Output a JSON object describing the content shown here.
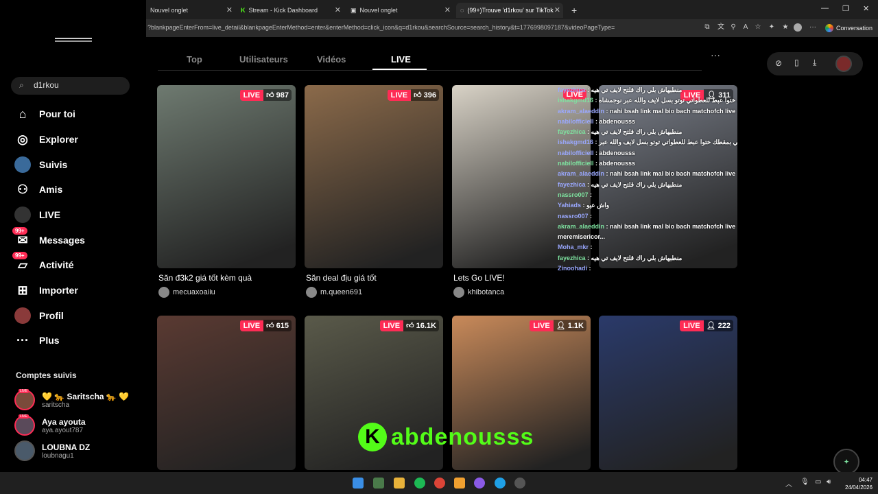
{
  "browser": {
    "tabs": [
      {
        "label": "Nouvel onglet"
      },
      {
        "label": "Stream - Kick Dashboard"
      },
      {
        "label": "Nouvel onglet"
      },
      {
        "label": "(99+)Trouve 'd1rkou' sur TikTok | ..."
      }
    ],
    "url": "?blankpageEnterFrom=live_detail&blankpageEnterMethod=enter&enterMethod=click_icon&q=d1rkou&searchSource=search_history&t=1776998097187&videoPageType=",
    "conversation_label": "Conversation"
  },
  "search": {
    "value": "d1rkou"
  },
  "nav": [
    {
      "label": "Pour toi",
      "icon": "home-icon"
    },
    {
      "label": "Explorer",
      "icon": "compass-icon"
    },
    {
      "label": "Suivis",
      "icon": "following-avatar-icon"
    },
    {
      "label": "Amis",
      "icon": "friends-icon"
    },
    {
      "label": "LIVE",
      "icon": "live-icon"
    },
    {
      "label": "Messages",
      "icon": "messages-icon",
      "badge": "99+"
    },
    {
      "label": "Activité",
      "icon": "activity-icon",
      "badge": "99+"
    },
    {
      "label": "Importer",
      "icon": "upload-icon"
    },
    {
      "label": "Profil",
      "icon": "profile-avatar-icon"
    },
    {
      "label": "Plus",
      "icon": "more-icon"
    }
  ],
  "followed": {
    "title": "Comptes suivis",
    "accounts": [
      {
        "name": "💛 🐆 Saritscha 🐆 💛",
        "handle": "saritscha",
        "live": "LIVE"
      },
      {
        "name": "Aya ayouta",
        "handle": "aya.ayout787",
        "live": "LIVE"
      },
      {
        "name": "LOUBNA DZ",
        "handle": "loubnagu1",
        "live": ""
      }
    ]
  },
  "filter_tabs": [
    "Top",
    "Utilisateurs",
    "Vidéos",
    "LIVE"
  ],
  "active_tab": "LIVE",
  "live_badge": "LIVE",
  "cards": [
    {
      "count": "987",
      "count_icon": "like-icon",
      "title": "Săn đ3k2 giá tốt kèm quà",
      "user": "mecuaxoaiiu",
      "bg": "#6e7a70"
    },
    {
      "count": "396",
      "count_icon": "like-icon",
      "title": "Săn deal địu giá tốt",
      "user": "m.queen691",
      "bg": "#8b6a4a"
    },
    {
      "count": "",
      "count_icon": "",
      "title": "Lets Go LIVE!",
      "user": "khibotanca",
      "bg": "#d8d2c6"
    },
    {
      "count": "311",
      "count_icon": "viewer-icon",
      "title": "",
      "user": "",
      "bg": "#7a7f8a"
    },
    {
      "count": "615",
      "count_icon": "like-icon",
      "title": "",
      "user": "",
      "bg": "#5a3a32"
    },
    {
      "count": "16.1K",
      "count_icon": "like-icon",
      "title": "",
      "user": "",
      "bg": "#5a5a4a"
    },
    {
      "count": "1.1K",
      "count_icon": "viewer-icon",
      "title": "",
      "user": "",
      "bg": "#c98a5a"
    },
    {
      "count": "222",
      "count_icon": "viewer-icon",
      "title": "",
      "user": "",
      "bg": "#2a3a6a"
    }
  ],
  "chat": [
    {
      "user": "fayezhica",
      "msg": "منطبهاش بلي راك قلتح لايف تي هيه"
    },
    {
      "user": "ishakgmd16",
      "msg": "عيو ربي بمقطك ختوا عبط للعطواتي توتو بسل لايف والله عبر نوجمشاه"
    },
    {
      "user": "akram_alaeddin",
      "msg": "nahi bsah link mal bio bach matchofch live"
    },
    {
      "user": "nabilofficiell",
      "msg": "abdenousss"
    },
    {
      "user": "fayezhica",
      "msg": "منطبهاش بلي راك قلتح لايف تي هيه"
    },
    {
      "user": "ishakgmd16",
      "msg": "عيو ربي بمقطك ختوا عبط للعطواتي توتو بسل لايف والله عبر"
    },
    {
      "user": "nabilofficiell",
      "msg": "abdenousss"
    },
    {
      "user": "nabilofficiell",
      "msg": "abdenousss"
    },
    {
      "user": "akram_alaeddin",
      "msg": "nahi bsah link mal bio bach matchofch live"
    },
    {
      "user": "fayezhica",
      "msg": "منطبهاش بلي راك قلتح لايف تي هيه"
    },
    {
      "user": "nassro007",
      "msg": ""
    },
    {
      "user": "Yahiads",
      "msg": "واش عيو"
    },
    {
      "user": "nassro007",
      "msg": ""
    },
    {
      "user": "akram_alaeddin",
      "msg": "nahi bsah link mal bio bach matchofch live"
    },
    {
      "user": "",
      "msg": "meremisericor..."
    },
    {
      "user": "Moha_mkr",
      "msg": ""
    },
    {
      "user": "fayezhica",
      "msg": "منطبهاش بلي راك قلتح لايف تي هيه"
    },
    {
      "user": "Zinoohadi",
      "msg": ""
    }
  ],
  "kick_overlay": {
    "name": "abdenousss"
  },
  "taskbar": {
    "time": "04:47",
    "date": "24/04/2026"
  },
  "colors": {
    "accent": "#fe2c55",
    "kick": "#53fc18",
    "background": "#000000"
  }
}
